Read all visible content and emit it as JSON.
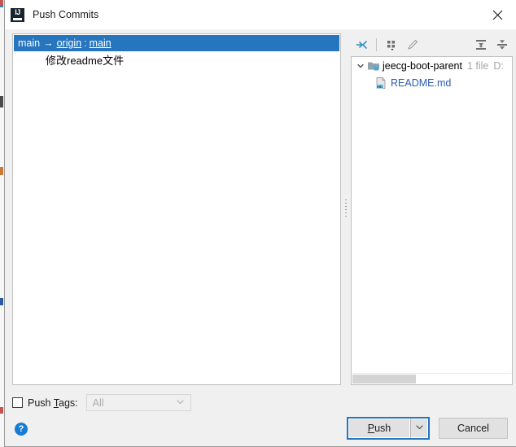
{
  "window": {
    "title": "Push Commits",
    "app_icon": "intellij-idea-icon",
    "close_icon": "close-icon"
  },
  "commits": {
    "selected_row": {
      "source_branch": "main",
      "arrow": "→",
      "remote": "origin",
      "colon": ":",
      "target_branch": "main"
    },
    "entries": [
      {
        "message": "修改readme文件"
      }
    ]
  },
  "splitter": {
    "name": "panel-splitter"
  },
  "changes": {
    "toolbar": [
      {
        "name": "show-diff-button",
        "icon": "diff-arrows-icon",
        "enabled": true
      },
      {
        "name": "group-by-button",
        "icon": "group-by-icon",
        "enabled": true
      },
      {
        "name": "edit-source-button",
        "icon": "pencil-icon",
        "enabled": false
      },
      {
        "name": "expand-all-button",
        "icon": "expand-all-icon",
        "enabled": true
      },
      {
        "name": "collapse-all-button",
        "icon": "collapse-all-icon",
        "enabled": true
      }
    ],
    "tree": {
      "root": {
        "label": "jeecg-boot-parent",
        "file_count": "1 file",
        "path": "D:",
        "expanded": true,
        "chevron_icon": "chevron-down-icon",
        "folder_icon": "module-folder-icon"
      },
      "children": [
        {
          "label": "README.md",
          "icon": "markdown-file-icon"
        }
      ]
    },
    "scrollbar": {
      "name": "horizontal-scrollbar"
    }
  },
  "push_tags": {
    "checked": false,
    "label_prefix": "Push ",
    "label_accel": "T",
    "label_suffix": "ags:",
    "select_value": "All",
    "select_enabled": false,
    "caret_icon": "chevron-down-icon"
  },
  "footer": {
    "help_label": "?",
    "help_icon": "help-icon",
    "push_prefix": "",
    "push_accel": "P",
    "push_suffix": "ush",
    "push_dropdown_icon": "chevron-down-icon",
    "cancel_label": "Cancel"
  },
  "colors": {
    "selection_blue": "#2675bf",
    "link_blue": "#2a5db0",
    "accent_focus": "#2675bf",
    "muted_gray": "#a5a5a5",
    "dialog_bg": "#f0f0f0"
  }
}
